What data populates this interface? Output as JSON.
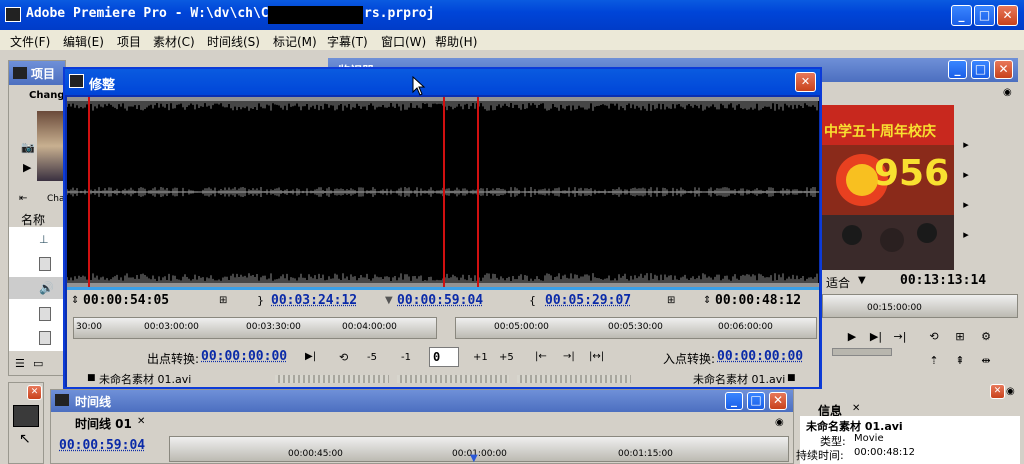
{
  "window": {
    "title": "Adobe Premiere Pro - W:\\dv\\ch\\C",
    "title_tail": "rs.prproj"
  },
  "menu": [
    "文件(F)",
    "编辑(E)",
    "项目",
    "素材(C)",
    "时间线(S)",
    "标记(M)",
    "字幕(T)",
    "窗口(W)",
    "帮助(H)"
  ],
  "project_panel": {
    "title": "项目",
    "tab": "Chang",
    "side_label": "Cha",
    "col_name": "名称"
  },
  "source_panel": {
    "tab": "监视器"
  },
  "trim": {
    "title": "修整",
    "tc_left_duration": "00:00:54:05",
    "tc_left_out": "00:03:24:12",
    "tc_playhead": "00:00:59:04",
    "tc_right_in": "00:05:29:07",
    "tc_right_duration": "00:00:48:12",
    "ruler_left": [
      "30:00",
      "00:03:00:00",
      "00:03:30:00",
      "00:04:00:00"
    ],
    "ruler_right": [
      "00:05:00:00",
      "00:05:30:00",
      "00:06:00:00"
    ],
    "out_shift_label": "出点转换:",
    "out_shift_value": "00:00:00:00",
    "in_shift_label": "入点转换:",
    "in_shift_value": "00:00:00:00",
    "minus5": "-5",
    "minus1": "-1",
    "frame_value": "0",
    "plus1": "+1",
    "plus5": "+5",
    "clip_left": "未命名素材 01.avi",
    "clip_right": "未命名素材 01.avi"
  },
  "program_monitor": {
    "fit_label": "适合",
    "timecode": "00:13:13:14",
    "ruler_label": "00:15:00:00",
    "image_text_top": "中学五十周年校庆",
    "image_text_big": "956"
  },
  "timeline": {
    "title": "时间线",
    "tab": "时间线 01",
    "timecode": "00:00:59:04",
    "ruler": [
      "00:00:45:00",
      "00:01:00:00",
      "00:01:15:00"
    ]
  },
  "info": {
    "tab": "信息",
    "name": "未命名素材 01.avi",
    "type_label": "类型:",
    "type_value": "Movie",
    "duration_label": "持续时间:",
    "duration_value": "00:00:48:12"
  },
  "colors": {
    "xp_blue": "#0045d8",
    "cut_line": "#d01010",
    "timecode_blue": "#0a2aa8"
  }
}
